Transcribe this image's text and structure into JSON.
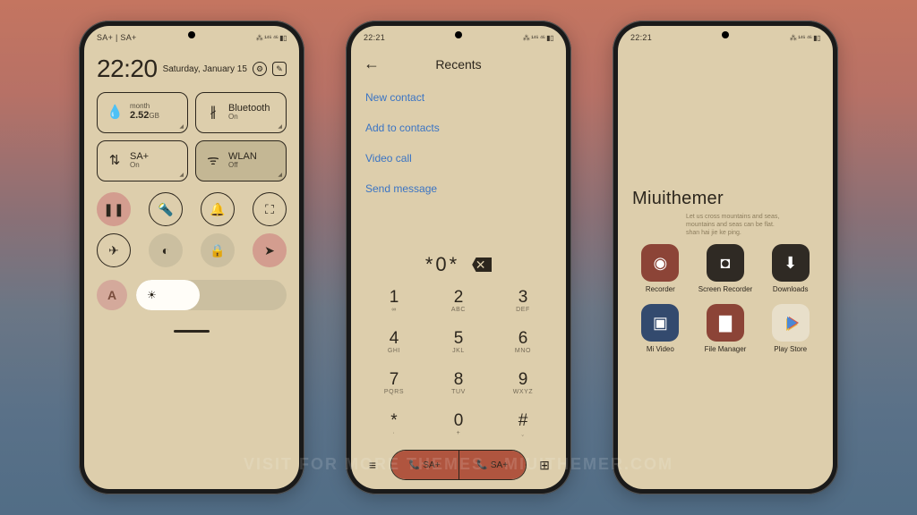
{
  "watermark": "Visit for more themes · miuithemer.com",
  "phone1": {
    "status_left": "SA+ | SA+",
    "status_right": "⁂ ¹⁴⁶ ⁴⁶ ▮▯",
    "time": "22:20",
    "date": "Saturday, January 15",
    "tiles": {
      "data": {
        "label": "2.52",
        "unit": "GB",
        "sub": "month"
      },
      "bt": {
        "label": "Bluetooth",
        "sub": "On"
      },
      "sim": {
        "label": "SA+",
        "sub": "On"
      },
      "wlan": {
        "label": "WLAN",
        "sub": "Off"
      }
    },
    "avatar_letter": "A"
  },
  "phone2": {
    "status_left": "22:21",
    "status_right": "⁂ ¹⁴⁶ ⁴⁶ ▮▯",
    "title": "Recents",
    "actions": [
      "New contact",
      "Add to contacts",
      "Video call",
      "Send message"
    ],
    "entered": "*0*",
    "keys": [
      {
        "n": "1",
        "l": "∞"
      },
      {
        "n": "2",
        "l": "ABC"
      },
      {
        "n": "3",
        "l": "DEF"
      },
      {
        "n": "4",
        "l": "GHI"
      },
      {
        "n": "5",
        "l": "JKL"
      },
      {
        "n": "6",
        "l": "MNO"
      },
      {
        "n": "7",
        "l": "PQRS"
      },
      {
        "n": "8",
        "l": "TUV"
      },
      {
        "n": "9",
        "l": "WXYZ"
      },
      {
        "n": "*",
        "l": "·"
      },
      {
        "n": "0",
        "l": "+"
      },
      {
        "n": "#",
        "l": "ˬ"
      }
    ],
    "sim1": "SA+",
    "sim2": "SA+"
  },
  "phone3": {
    "status_left": "22:21",
    "status_right": "⁂ ¹⁴⁶ ⁴⁶ ▮▯",
    "folder": "Miuithemer",
    "apps": [
      {
        "name": "Recorder",
        "cls": "ai-rec",
        "glyph": "◉"
      },
      {
        "name": "Screen Recorder",
        "cls": "ai-scr",
        "glyph": "◘"
      },
      {
        "name": "Downloads",
        "cls": "ai-dl",
        "glyph": "⬇"
      },
      {
        "name": "Mi Video",
        "cls": "ai-vid",
        "glyph": "▣"
      },
      {
        "name": "File Manager",
        "cls": "ai-fm",
        "glyph": "▇"
      },
      {
        "name": "Play Store",
        "cls": "ai-ps",
        "glyph": ""
      }
    ]
  }
}
